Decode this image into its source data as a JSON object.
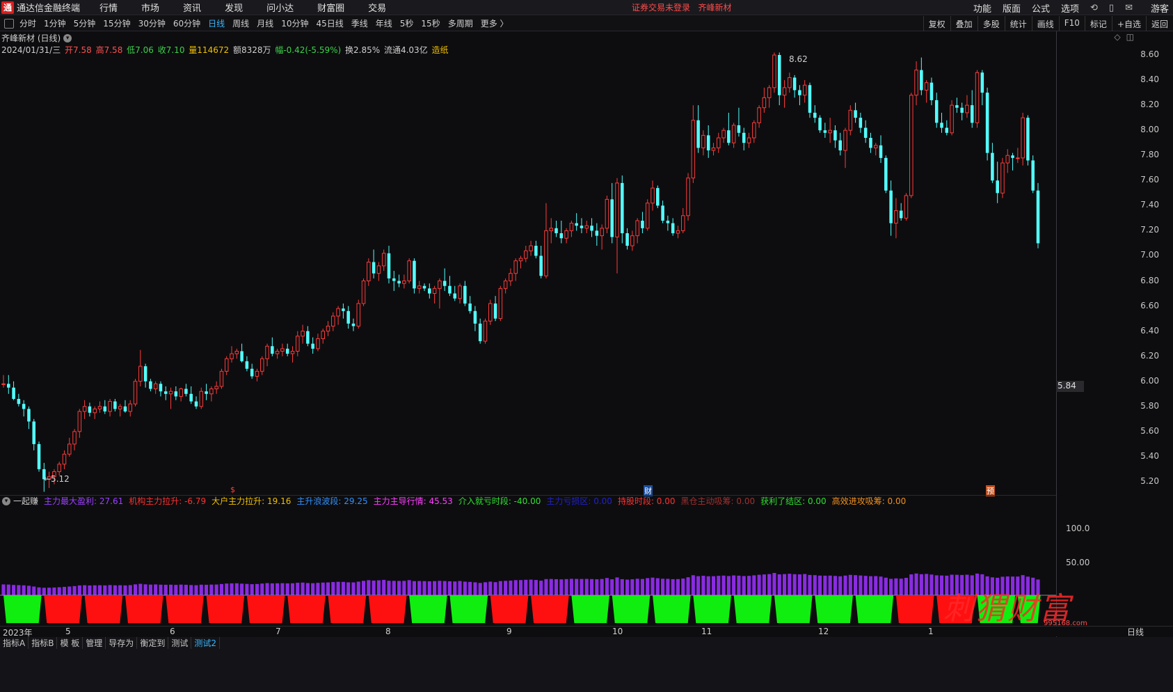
{
  "app": {
    "logo_char": "通",
    "title": "通达信金融终端"
  },
  "menu": [
    "行情",
    "市场",
    "资讯",
    "发现",
    "问小达",
    "财富圈",
    "交易"
  ],
  "status": {
    "login": "证券交易未登录",
    "stock": "齐峰新材"
  },
  "right_menu": [
    "功能",
    "版面",
    "公式",
    "选项"
  ],
  "right_icons": [
    "refresh-icon",
    "phone-icon",
    "mail-icon"
  ],
  "guest": "游客",
  "periods": [
    "分时",
    "1分钟",
    "5分钟",
    "15分钟",
    "30分钟",
    "60分钟",
    "日线",
    "周线",
    "月线",
    "10分钟",
    "45日线",
    "季线",
    "年线",
    "5秒",
    "15秒",
    "多周期",
    "更多 〉"
  ],
  "active_period": "日线",
  "tools": [
    "复权",
    "叠加",
    "多股",
    "统计",
    "画线",
    "F10",
    "标记",
    "+自选",
    "返回"
  ],
  "stock_title": "齐峰新材 (日线)",
  "ohlc": {
    "date": "2024/01/31/三",
    "open": "开7.58",
    "high": "高7.58",
    "low": "低7.06",
    "close": "收7.10",
    "volume": "量114672",
    "amount": "额8328万",
    "change": "幅-0.42(-5.59%)",
    "turnover": "换2.85%",
    "float": "流通4.03亿",
    "sector": "造纸"
  },
  "price_axis": [
    "8.60",
    "8.40",
    "8.20",
    "8.00",
    "7.80",
    "7.60",
    "7.40",
    "7.20",
    "7.00",
    "6.80",
    "6.60",
    "6.40",
    "6.20",
    "6.00",
    "5.80",
    "5.60",
    "5.40",
    "5.20"
  ],
  "current_price_tag": "5.84",
  "high_mark": "8.62",
  "low_mark": "←5.12",
  "event_marks": [
    "$",
    "财",
    "预"
  ],
  "indicator": {
    "name": "一起赚",
    "items": [
      {
        "label": "主力最大盈利: 27.61",
        "color": "#9b40ff"
      },
      {
        "label": "机构主力拉升: -6.79",
        "color": "#ff3030"
      },
      {
        "label": "大户主力拉升: 19.16",
        "color": "#f0c000"
      },
      {
        "label": "主升浪波段: 29.25",
        "color": "#3090ff"
      },
      {
        "label": "主力主导行情: 45.53",
        "color": "#ff40ff"
      },
      {
        "label": "介入就亏时段: -40.00",
        "color": "#30e030"
      },
      {
        "label": "主力亏损区: 0.00",
        "color": "#2020d0"
      },
      {
        "label": "持股时段: 0.00",
        "color": "#ff3030"
      },
      {
        "label": "黑仓主动吸筹: 0.00",
        "color": "#a03030"
      },
      {
        "label": "获利了结区: 0.00",
        "color": "#30e030"
      },
      {
        "label": "高效进攻吸筹: 0.00",
        "color": "#f09020"
      }
    ]
  },
  "sub_axis": [
    "100.0",
    "50.00"
  ],
  "date_axis": [
    "2023年",
    "5",
    "6",
    "7",
    "8",
    "9",
    "10",
    "11",
    "12",
    "1"
  ],
  "period_label": "日线",
  "bottom_tabs": [
    "指标A",
    "指标B",
    "模 板",
    "管理",
    "导存为",
    "衡定到",
    "测试",
    "测试2"
  ],
  "active_tab": "测试2",
  "watermark": "刺猬财富",
  "watermark_url": "995168.com",
  "colors": {
    "up": "#ff3b3b",
    "down": "#54ffff",
    "axis": "#3a3a40",
    "accent": "#38b6ff"
  },
  "chart_data": {
    "type": "candlestick",
    "ylim": [
      5.1,
      8.65
    ],
    "ohlc": [
      [
        5.98,
        6.05,
        5.95,
        5.98
      ],
      [
        5.98,
        6.05,
        5.9,
        5.95
      ],
      [
        5.95,
        6.0,
        5.85,
        5.86
      ],
      [
        5.86,
        5.9,
        5.8,
        5.82
      ],
      [
        5.82,
        5.85,
        5.72,
        5.78
      ],
      [
        5.78,
        5.8,
        5.62,
        5.68
      ],
      [
        5.68,
        5.7,
        5.45,
        5.5
      ],
      [
        5.5,
        5.52,
        5.28,
        5.3
      ],
      [
        5.3,
        5.35,
        5.12,
        5.22
      ],
      [
        5.22,
        5.28,
        5.15,
        5.24
      ],
      [
        5.24,
        5.3,
        5.18,
        5.28
      ],
      [
        5.28,
        5.36,
        5.25,
        5.34
      ],
      [
        5.34,
        5.45,
        5.3,
        5.42
      ],
      [
        5.42,
        5.55,
        5.4,
        5.5
      ],
      [
        5.5,
        5.62,
        5.45,
        5.6
      ],
      [
        5.6,
        5.78,
        5.55,
        5.76
      ],
      [
        5.76,
        5.85,
        5.7,
        5.8
      ],
      [
        5.8,
        5.83,
        5.72,
        5.75
      ],
      [
        5.75,
        5.8,
        5.7,
        5.78
      ],
      [
        5.78,
        5.84,
        5.75,
        5.8
      ],
      [
        5.8,
        5.85,
        5.74,
        5.76
      ],
      [
        5.76,
        5.86,
        5.72,
        5.84
      ],
      [
        5.84,
        5.86,
        5.76,
        5.78
      ],
      [
        5.78,
        5.82,
        5.72,
        5.8
      ],
      [
        5.8,
        5.85,
        5.75,
        5.76
      ],
      [
        5.76,
        5.85,
        5.72,
        5.82
      ],
      [
        5.82,
        6.02,
        5.8,
        6.0
      ],
      [
        6.0,
        6.25,
        5.96,
        6.12
      ],
      [
        6.12,
        6.14,
        5.95,
        6.0
      ],
      [
        6.0,
        6.02,
        5.92,
        5.94
      ],
      [
        5.94,
        6.0,
        5.9,
        5.98
      ],
      [
        5.98,
        6.0,
        5.88,
        5.92
      ],
      [
        5.92,
        5.96,
        5.85,
        5.9
      ],
      [
        5.9,
        5.95,
        5.78,
        5.92
      ],
      [
        5.92,
        5.96,
        5.85,
        5.88
      ],
      [
        5.88,
        5.95,
        5.84,
        5.94
      ],
      [
        5.94,
        5.98,
        5.88,
        5.9
      ],
      [
        5.9,
        5.96,
        5.82,
        5.84
      ],
      [
        5.84,
        5.88,
        5.78,
        5.8
      ],
      [
        5.8,
        5.95,
        5.78,
        5.92
      ],
      [
        5.92,
        5.98,
        5.85,
        5.9
      ],
      [
        5.9,
        5.96,
        5.84,
        5.94
      ],
      [
        5.94,
        6.0,
        5.9,
        5.96
      ],
      [
        5.96,
        6.1,
        5.94,
        6.08
      ],
      [
        6.08,
        6.2,
        6.05,
        6.18
      ],
      [
        6.18,
        6.28,
        6.15,
        6.22
      ],
      [
        6.22,
        6.26,
        6.18,
        6.24
      ],
      [
        6.24,
        6.3,
        6.15,
        6.16
      ],
      [
        6.16,
        6.2,
        6.08,
        6.1
      ],
      [
        6.1,
        6.14,
        6.02,
        6.04
      ],
      [
        6.04,
        6.1,
        6.0,
        6.08
      ],
      [
        6.08,
        6.2,
        6.05,
        6.18
      ],
      [
        6.18,
        6.3,
        6.12,
        6.28
      ],
      [
        6.28,
        6.35,
        6.2,
        6.22
      ],
      [
        6.22,
        6.26,
        6.18,
        6.24
      ],
      [
        6.24,
        6.3,
        6.2,
        6.26
      ],
      [
        6.26,
        6.3,
        6.2,
        6.22
      ],
      [
        6.22,
        6.28,
        6.15,
        6.24
      ],
      [
        6.24,
        6.4,
        6.2,
        6.36
      ],
      [
        6.36,
        6.45,
        6.3,
        6.4
      ],
      [
        6.4,
        6.44,
        6.28,
        6.3
      ],
      [
        6.3,
        6.35,
        6.22,
        6.26
      ],
      [
        6.26,
        6.38,
        6.24,
        6.34
      ],
      [
        6.34,
        6.42,
        6.3,
        6.4
      ],
      [
        6.4,
        6.48,
        6.36,
        6.44
      ],
      [
        6.44,
        6.55,
        6.4,
        6.52
      ],
      [
        6.52,
        6.6,
        6.45,
        6.58
      ],
      [
        6.58,
        6.62,
        6.5,
        6.56
      ],
      [
        6.56,
        6.6,
        6.42,
        6.46
      ],
      [
        6.46,
        6.5,
        6.4,
        6.44
      ],
      [
        6.44,
        6.65,
        6.42,
        6.62
      ],
      [
        6.62,
        6.82,
        6.6,
        6.8
      ],
      [
        6.8,
        6.98,
        6.76,
        6.95
      ],
      [
        6.95,
        7.05,
        6.82,
        6.86
      ],
      [
        6.86,
        6.95,
        6.8,
        6.92
      ],
      [
        6.92,
        7.05,
        6.88,
        7.02
      ],
      [
        7.02,
        7.08,
        6.78,
        6.82
      ],
      [
        6.82,
        6.88,
        6.72,
        6.8
      ],
      [
        6.8,
        6.85,
        6.75,
        6.78
      ],
      [
        6.78,
        6.85,
        6.74,
        6.8
      ],
      [
        6.8,
        6.98,
        6.78,
        6.96
      ],
      [
        6.96,
        6.98,
        6.7,
        6.74
      ],
      [
        6.74,
        6.8,
        6.7,
        6.76
      ],
      [
        6.76,
        6.78,
        6.72,
        6.74
      ],
      [
        6.74,
        6.78,
        6.66,
        6.7
      ],
      [
        6.7,
        6.76,
        6.62,
        6.74
      ],
      [
        6.74,
        6.82,
        6.58,
        6.8
      ],
      [
        6.8,
        6.9,
        6.72,
        6.76
      ],
      [
        6.76,
        6.84,
        6.68,
        6.7
      ],
      [
        6.7,
        6.76,
        6.64,
        6.66
      ],
      [
        6.66,
        6.78,
        6.62,
        6.76
      ],
      [
        6.76,
        6.8,
        6.6,
        6.62
      ],
      [
        6.62,
        6.68,
        6.54,
        6.56
      ],
      [
        6.56,
        6.6,
        6.4,
        6.46
      ],
      [
        6.46,
        6.5,
        6.3,
        6.32
      ],
      [
        6.32,
        6.5,
        6.3,
        6.48
      ],
      [
        6.48,
        6.65,
        6.45,
        6.62
      ],
      [
        6.62,
        6.68,
        6.48,
        6.5
      ],
      [
        6.5,
        6.76,
        6.48,
        6.74
      ],
      [
        6.74,
        6.82,
        6.7,
        6.8
      ],
      [
        6.8,
        6.9,
        6.76,
        6.86
      ],
      [
        6.86,
        6.98,
        6.8,
        6.96
      ],
      [
        6.96,
        7.0,
        6.9,
        6.98
      ],
      [
        6.98,
        7.08,
        6.95,
        7.04
      ],
      [
        7.04,
        7.12,
        7.0,
        7.08
      ],
      [
        7.08,
        7.12,
        6.98,
        7.0
      ],
      [
        7.0,
        7.08,
        6.82,
        6.84
      ],
      [
        6.84,
        7.42,
        6.82,
        7.2
      ],
      [
        7.2,
        7.3,
        7.1,
        7.22
      ],
      [
        7.22,
        7.28,
        7.15,
        7.18
      ],
      [
        7.18,
        7.28,
        7.1,
        7.14
      ],
      [
        7.14,
        7.22,
        7.1,
        7.2
      ],
      [
        7.2,
        7.28,
        7.15,
        7.26
      ],
      [
        7.26,
        7.34,
        7.2,
        7.24
      ],
      [
        7.24,
        7.3,
        7.18,
        7.22
      ],
      [
        7.22,
        7.28,
        7.18,
        7.24
      ],
      [
        7.24,
        7.3,
        7.15,
        7.2
      ],
      [
        7.2,
        7.26,
        7.08,
        7.16
      ],
      [
        7.16,
        7.25,
        7.05,
        7.22
      ],
      [
        7.22,
        7.48,
        7.18,
        7.45
      ],
      [
        7.45,
        7.58,
        7.1,
        7.15
      ],
      [
        7.15,
        7.62,
        6.86,
        7.58
      ],
      [
        7.58,
        7.64,
        7.1,
        7.18
      ],
      [
        7.18,
        7.22,
        7.05,
        7.08
      ],
      [
        7.08,
        7.2,
        7.04,
        7.16
      ],
      [
        7.16,
        7.3,
        7.1,
        7.28
      ],
      [
        7.28,
        7.35,
        7.18,
        7.22
      ],
      [
        7.22,
        7.45,
        7.2,
        7.42
      ],
      [
        7.42,
        7.6,
        7.36,
        7.54
      ],
      [
        7.54,
        7.56,
        7.38,
        7.4
      ],
      [
        7.4,
        7.44,
        7.26,
        7.28
      ],
      [
        7.28,
        7.32,
        7.2,
        7.26
      ],
      [
        7.26,
        7.3,
        7.16,
        7.18
      ],
      [
        7.18,
        7.24,
        7.14,
        7.2
      ],
      [
        7.2,
        7.38,
        7.18,
        7.32
      ],
      [
        7.32,
        7.66,
        7.28,
        7.62
      ],
      [
        7.62,
        8.2,
        7.58,
        8.08
      ],
      [
        8.08,
        8.2,
        7.82,
        7.86
      ],
      [
        7.86,
        8.0,
        7.8,
        7.96
      ],
      [
        7.96,
        8.04,
        7.78,
        7.84
      ],
      [
        7.84,
        7.9,
        7.8,
        7.86
      ],
      [
        7.86,
        7.98,
        7.82,
        7.94
      ],
      [
        7.94,
        8.02,
        7.9,
        8.0
      ],
      [
        8.0,
        8.14,
        7.88,
        7.9
      ],
      [
        7.9,
        8.06,
        7.86,
        8.04
      ],
      [
        8.04,
        8.18,
        7.95,
        7.98
      ],
      [
        7.98,
        8.02,
        7.84,
        7.9
      ],
      [
        7.9,
        7.98,
        7.86,
        7.94
      ],
      [
        7.94,
        8.08,
        7.9,
        8.06
      ],
      [
        8.06,
        8.2,
        8.02,
        8.18
      ],
      [
        8.18,
        8.34,
        8.14,
        8.26
      ],
      [
        8.26,
        8.36,
        8.18,
        8.34
      ],
      [
        8.34,
        8.62,
        8.3,
        8.6
      ],
      [
        8.6,
        8.62,
        8.2,
        8.28
      ],
      [
        8.28,
        8.4,
        8.18,
        8.34
      ],
      [
        8.34,
        8.46,
        8.3,
        8.42
      ],
      [
        8.42,
        8.44,
        8.26,
        8.32
      ],
      [
        8.32,
        8.36,
        8.2,
        8.28
      ],
      [
        8.28,
        8.4,
        8.22,
        8.36
      ],
      [
        8.36,
        8.38,
        8.1,
        8.14
      ],
      [
        8.14,
        8.2,
        8.06,
        8.1
      ],
      [
        8.1,
        8.12,
        7.98,
        8.0
      ],
      [
        8.0,
        8.06,
        7.94,
        7.98
      ],
      [
        7.98,
        8.1,
        7.9,
        8.0
      ],
      [
        8.0,
        8.04,
        7.86,
        7.92
      ],
      [
        7.92,
        7.98,
        7.8,
        7.84
      ],
      [
        7.84,
        8.02,
        7.7,
        8.0
      ],
      [
        8.0,
        8.2,
        7.96,
        8.16
      ],
      [
        8.16,
        8.22,
        8.06,
        8.1
      ],
      [
        8.1,
        8.14,
        7.98,
        8.02
      ],
      [
        8.02,
        8.08,
        7.9,
        7.94
      ],
      [
        7.94,
        7.98,
        7.82,
        7.86
      ],
      [
        7.86,
        7.9,
        7.8,
        7.88
      ],
      [
        7.88,
        7.96,
        7.74,
        7.78
      ],
      [
        7.78,
        7.8,
        7.5,
        7.52
      ],
      [
        7.52,
        7.6,
        7.16,
        7.26
      ],
      [
        7.26,
        7.46,
        7.14,
        7.36
      ],
      [
        7.36,
        7.42,
        7.28,
        7.3
      ],
      [
        7.3,
        7.5,
        7.28,
        7.48
      ],
      [
        7.48,
        8.3,
        7.46,
        8.28
      ],
      [
        8.28,
        8.55,
        8.2,
        8.48
      ],
      [
        8.48,
        8.58,
        8.28,
        8.32
      ],
      [
        8.32,
        8.4,
        8.22,
        8.38
      ],
      [
        8.38,
        8.42,
        8.2,
        8.24
      ],
      [
        8.24,
        8.3,
        8.02,
        8.06
      ],
      [
        8.06,
        8.14,
        7.98,
        8.02
      ],
      [
        8.02,
        8.08,
        7.96,
        7.98
      ],
      [
        7.98,
        8.24,
        7.96,
        8.2
      ],
      [
        8.2,
        8.26,
        8.14,
        8.18
      ],
      [
        8.18,
        8.22,
        8.08,
        8.14
      ],
      [
        8.14,
        8.28,
        8.1,
        8.2
      ],
      [
        8.2,
        8.32,
        8.02,
        8.06
      ],
      [
        8.06,
        8.48,
        8.02,
        8.46
      ],
      [
        8.46,
        8.48,
        8.2,
        8.3
      ],
      [
        8.3,
        8.34,
        7.76,
        7.82
      ],
      [
        7.82,
        7.9,
        7.58,
        7.6
      ],
      [
        7.6,
        7.75,
        7.42,
        7.5
      ],
      [
        7.5,
        7.78,
        7.46,
        7.74
      ],
      [
        7.74,
        7.85,
        7.66,
        7.8
      ],
      [
        7.8,
        7.82,
        7.68,
        7.78
      ],
      [
        7.78,
        7.86,
        7.74,
        7.78
      ],
      [
        7.78,
        8.14,
        7.72,
        8.1
      ],
      [
        8.1,
        8.12,
        7.72,
        7.76
      ],
      [
        7.76,
        7.8,
        7.5,
        7.52
      ],
      [
        7.52,
        7.58,
        7.06,
        7.1
      ]
    ]
  }
}
